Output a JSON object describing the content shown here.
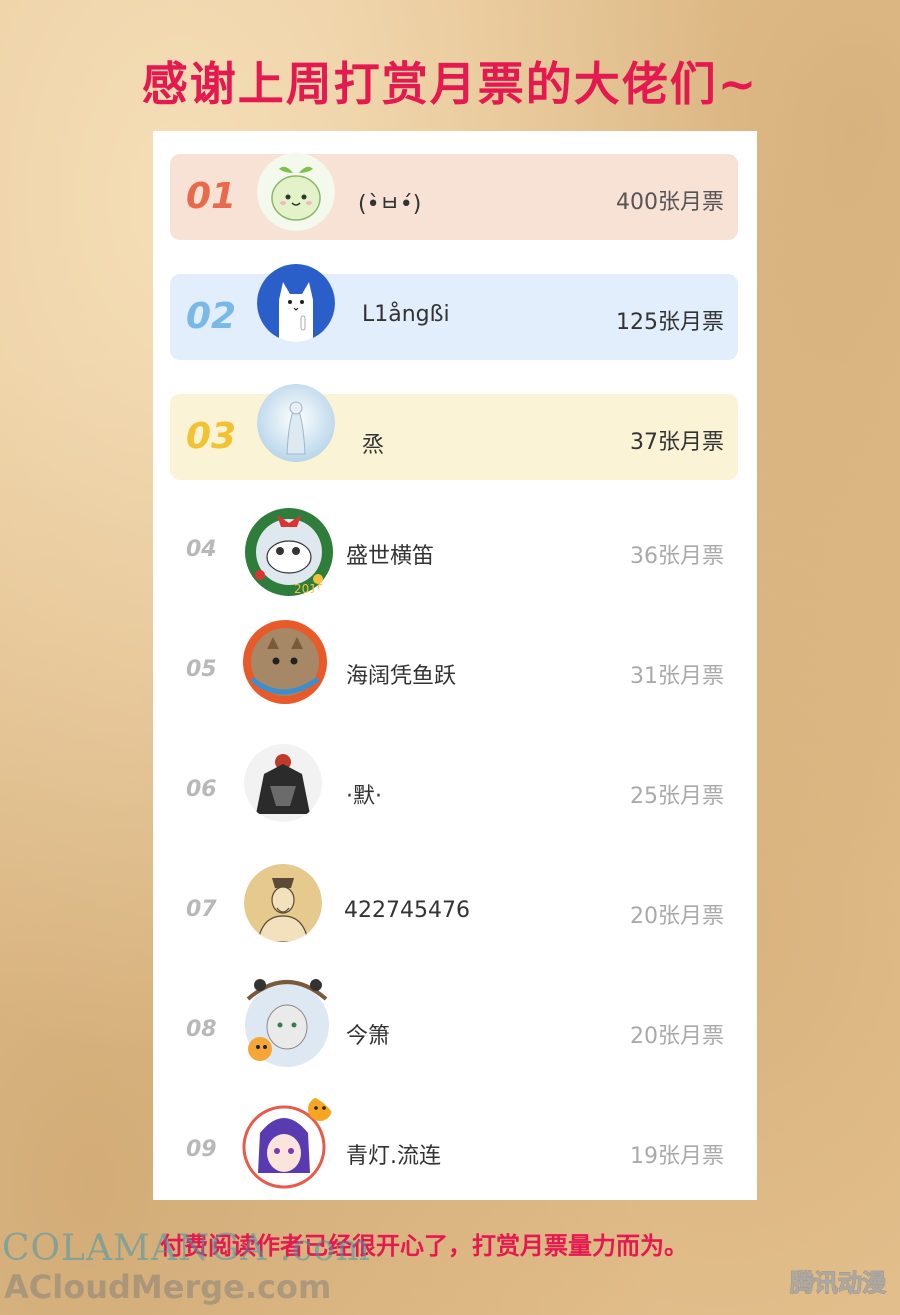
{
  "title": "感谢上周打赏月票的大佬们~",
  "footer": "付费阅读作者已经很开心了，打赏月票量力而为。",
  "watermark": {
    "line1": "COLAMANGA .com",
    "line2": "ACloudMerge.com",
    "brand": "腾讯动漫"
  },
  "colors": {
    "accent": "#e4194f",
    "rank1_bg": "#f8e2d6",
    "rank2_bg": "#e2eefb",
    "rank3_bg": "#fbf3d6"
  },
  "ranking": [
    {
      "rank": "01",
      "name": "(•̀ㅂ•́)",
      "votes": "400张月票"
    },
    {
      "rank": "02",
      "name": "L1ångßi",
      "votes": "125张月票"
    },
    {
      "rank": "03",
      "name": "烝",
      "votes": "37张月票"
    },
    {
      "rank": "04",
      "name": "盛世横笛",
      "votes": "36张月票"
    },
    {
      "rank": "05",
      "name": "海阔凭鱼跃",
      "votes": "31张月票"
    },
    {
      "rank": "06",
      "name": "·默·",
      "votes": "25张月票"
    },
    {
      "rank": "07",
      "name": "422745476",
      "votes": "20张月票"
    },
    {
      "rank": "08",
      "name": "今箫",
      "votes": "20张月票"
    },
    {
      "rank": "09",
      "name": "青灯.流连",
      "votes": "19张月票"
    }
  ]
}
